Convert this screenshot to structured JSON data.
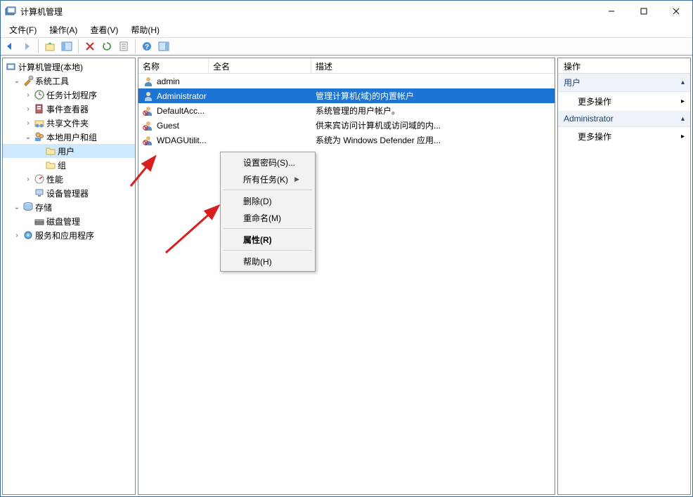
{
  "window": {
    "title": "计算机管理"
  },
  "menubar": [
    {
      "label": "文件(F)"
    },
    {
      "label": "操作(A)"
    },
    {
      "label": "查看(V)"
    },
    {
      "label": "帮助(H)"
    }
  ],
  "tree": {
    "root": "计算机管理(本地)",
    "system_tools": "系统工具",
    "task_scheduler": "任务计划程序",
    "event_viewer": "事件查看器",
    "shared_folders": "共享文件夹",
    "local_users": "本地用户和组",
    "users": "用户",
    "groups": "组",
    "performance": "性能",
    "device_mgr": "设备管理器",
    "storage": "存储",
    "disk_mgmt": "磁盘管理",
    "services_apps": "服务和应用程序"
  },
  "list": {
    "columns": {
      "name": "名称",
      "fullname": "全名",
      "desc": "描述"
    },
    "rows": [
      {
        "name": "admin",
        "full": "",
        "desc": ""
      },
      {
        "name": "Administrator",
        "full": "",
        "desc": "管理计算机(域)的内置帐户"
      },
      {
        "name": "DefaultAcc...",
        "full": "",
        "desc": "系统管理的用户帐户。"
      },
      {
        "name": "Guest",
        "full": "",
        "desc": "供来宾访问计算机或访问域的内..."
      },
      {
        "name": "WDAGUtilit...",
        "full": "",
        "desc": "系统为 Windows Defender 应用..."
      }
    ]
  },
  "context_menu": [
    {
      "label": "设置密码(S)...",
      "type": "item"
    },
    {
      "label": "所有任务(K)",
      "type": "submenu"
    },
    {
      "type": "sep"
    },
    {
      "label": "删除(D)",
      "type": "item"
    },
    {
      "label": "重命名(M)",
      "type": "item"
    },
    {
      "type": "sep"
    },
    {
      "label": "属性(R)",
      "type": "item",
      "bold": true
    },
    {
      "type": "sep"
    },
    {
      "label": "帮助(H)",
      "type": "item"
    }
  ],
  "actions": {
    "header": "操作",
    "group1": "用户",
    "item_more": "更多操作",
    "group2": "Administrator"
  }
}
